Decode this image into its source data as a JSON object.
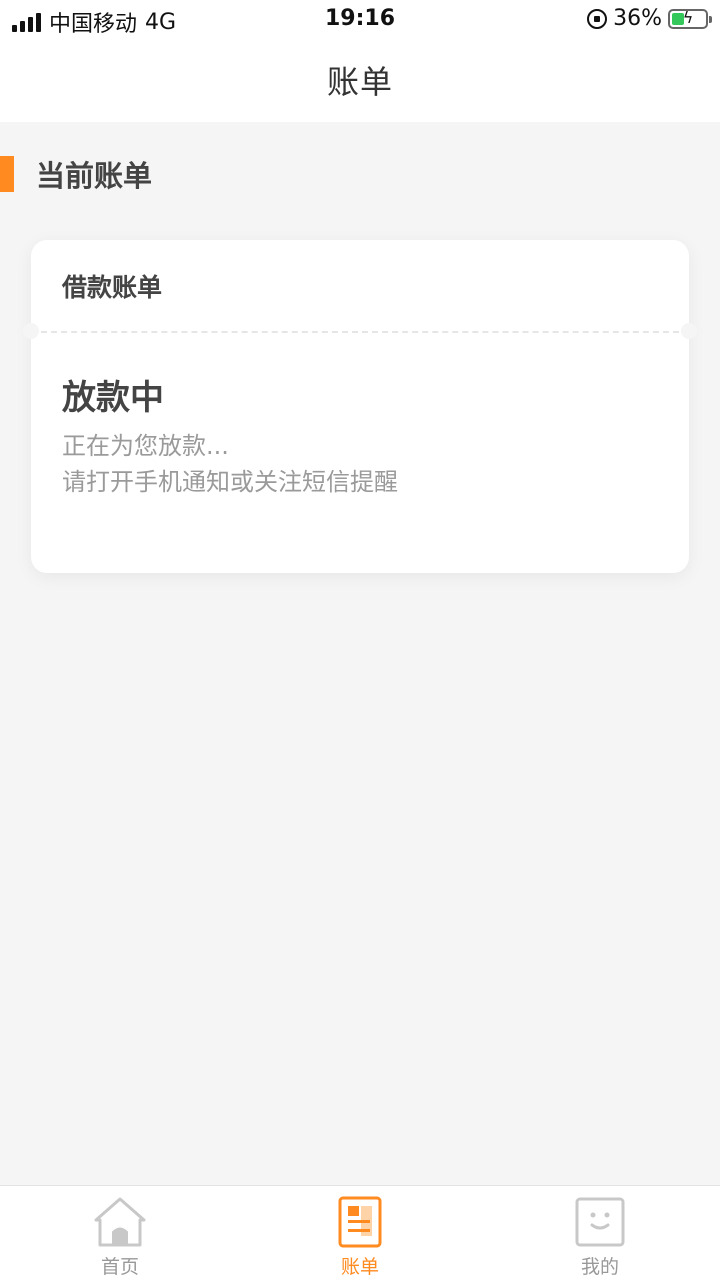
{
  "status_bar": {
    "carrier": "中国移动",
    "network": "4G",
    "time": "19:16",
    "battery_percent": "36%",
    "battery_level": 0.36
  },
  "nav": {
    "title": "账单"
  },
  "section": {
    "title": "当前账单"
  },
  "card": {
    "header": "借款账单",
    "status_title": "放款中",
    "lines": [
      "正在为您放款...",
      "请打开手机通知或关注短信提醒"
    ]
  },
  "tabs": [
    {
      "label": "首页",
      "icon": "home-icon",
      "active": false
    },
    {
      "label": "账单",
      "icon": "bill-icon",
      "active": true
    },
    {
      "label": "我的",
      "icon": "profile-icon",
      "active": false
    }
  ],
  "colors": {
    "accent": "#ff8a1f",
    "inactive": "#c8c8c8",
    "background": "#f5f5f5"
  }
}
